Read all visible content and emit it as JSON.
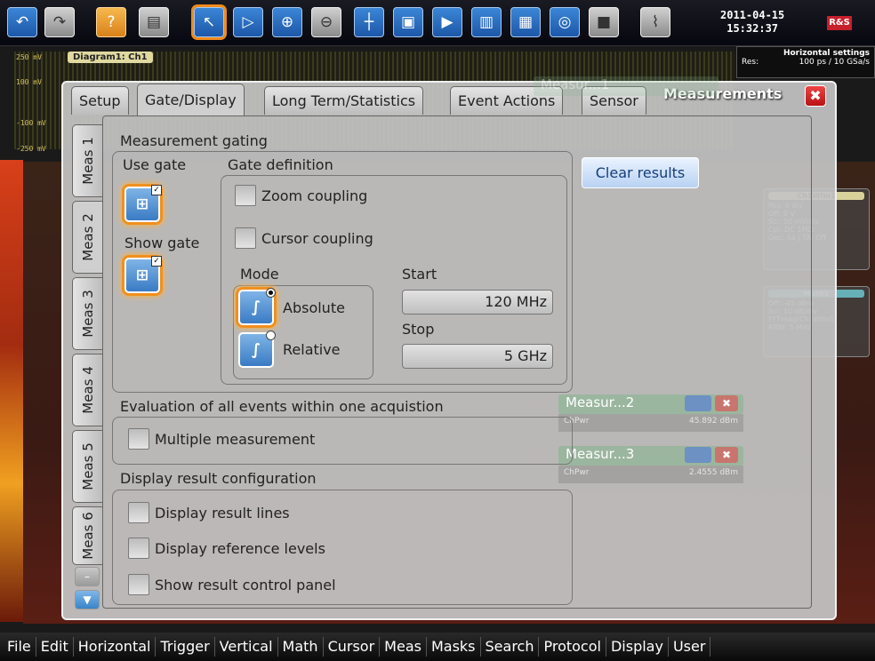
{
  "toolbar": {
    "datetime_date": "2011-04-15",
    "datetime_time": "15:32:37",
    "logo": "R&S"
  },
  "scope": {
    "diagram_label": "Diagram1: Ch1",
    "y_labels": [
      "250 mV",
      "100 mV",
      "-100 mV",
      "-250 mV"
    ],
    "horizontal_settings_title": "Horizontal settings",
    "horizontal_res_label": "Res:",
    "horizontal_res_value": "100 ps / 10 GSa/s"
  },
  "side_panels": {
    "ch1": {
      "title": "Ch1Wfm1",
      "lines": [
        "Pos: 0 div",
        "Off: 0 V",
        "Scl: 50 mV/div",
        "Cpl: DC 1MΩ",
        "Dec: Sa | TA: Off"
      ]
    },
    "math": {
      "title": "Math1",
      "lines": [
        "Off: -45 dBm",
        "Scl: 10 dB/div",
        "FFTmag(Ch1Wfm1)",
        "RBW: 5 MHz"
      ]
    }
  },
  "dialog": {
    "title": "Measurements",
    "close_label": "✖",
    "tabs": [
      "Setup",
      "Gate/Display",
      "Long Term/Statistics",
      "Event Actions",
      "Sensor"
    ],
    "meas_tabs": [
      "Meas 1",
      "Meas 2",
      "Meas 3",
      "Meas 4",
      "Meas 5",
      "Meas 6"
    ],
    "sections": {
      "gating": "Measurement gating",
      "use_gate": "Use gate",
      "show_gate": "Show gate",
      "gate_definition": "Gate definition",
      "zoom_coupling": "Zoom coupling",
      "cursor_coupling": "Cursor coupling",
      "mode": "Mode",
      "absolute": "Absolute",
      "relative": "Relative",
      "start": "Start",
      "stop": "Stop",
      "start_value": "120 MHz",
      "stop_value": "5 GHz",
      "evaluation": "Evaluation of all events within one acquistion",
      "multiple": "Multiple measurement",
      "display_config": "Display result configuration",
      "result_lines": "Display result lines",
      "reference_levels": "Display reference levels",
      "control_panel": "Show result control panel"
    },
    "clear_results": "Clear results"
  },
  "ghosts": {
    "m1": "Measur...1",
    "m2": "Measur...2",
    "m2_name": "ChPwr",
    "m2_val": "45.892 dBm",
    "m3": "Measur...3",
    "m3_name": "ChPwr",
    "m3_val": "2.4555 dBm"
  },
  "menubar": [
    "File",
    "Edit",
    "Horizontal",
    "Trigger",
    "Vertical",
    "Math",
    "Cursor",
    "Meas",
    "Masks",
    "Search",
    "Protocol",
    "Display",
    "User"
  ]
}
